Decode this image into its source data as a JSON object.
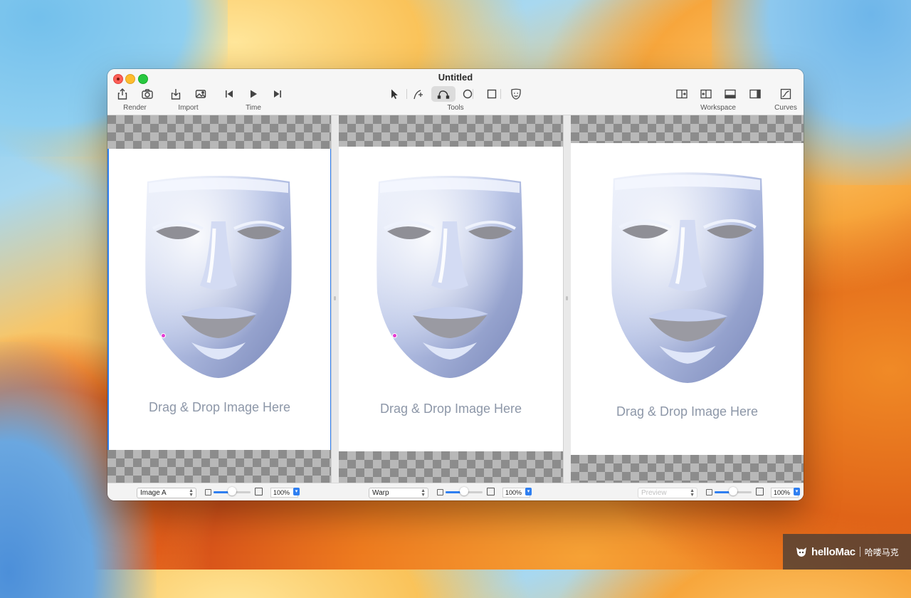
{
  "window": {
    "title": "Untitled"
  },
  "toolbar": {
    "groups": [
      {
        "label": "Render",
        "icons": [
          "share-icon",
          "camera-icon"
        ]
      },
      {
        "label": "Import",
        "icons": [
          "import-icon",
          "image-icon"
        ]
      },
      {
        "label": "Time",
        "icons": [
          "skip-back-icon",
          "play-icon",
          "skip-forward-icon"
        ]
      },
      {
        "label": "Tools",
        "icons": [
          "pointer-icon",
          "add-point-icon",
          "curve-tool-icon",
          "ellipse-tool-icon",
          "rectangle-tool-icon",
          "face-tool-icon"
        ],
        "active": "curve-tool-icon"
      },
      {
        "label": "Workspace",
        "icons": [
          "split-view-icon",
          "layout-icon",
          "bottom-panel-icon",
          "right-panel-icon"
        ]
      },
      {
        "label": "Curves",
        "icons": [
          "curves-icon"
        ]
      }
    ]
  },
  "panels": [
    {
      "id": "image-a",
      "drop_text": "Drag & Drop Image Here",
      "selector": "Image A",
      "zoom": "100%",
      "zoom_slider": 0.5,
      "selected": true,
      "disabled": false
    },
    {
      "id": "warp",
      "drop_text": "Drag & Drop Image Here",
      "selector": "Warp",
      "zoom": "100%",
      "zoom_slider": 0.5,
      "selected": false,
      "disabled": false
    },
    {
      "id": "preview",
      "drop_text": "Drag & Drop Image Here",
      "selector": "Preview",
      "zoom": "100%",
      "zoom_slider": 0.5,
      "selected": false,
      "disabled": true
    }
  ],
  "watermark": {
    "brand": "helloMac",
    "cn": "哈喽马克"
  },
  "colors": {
    "accent": "#2f7ff1",
    "pin": "#e53bd3",
    "drop_text": "#8d97a8"
  }
}
